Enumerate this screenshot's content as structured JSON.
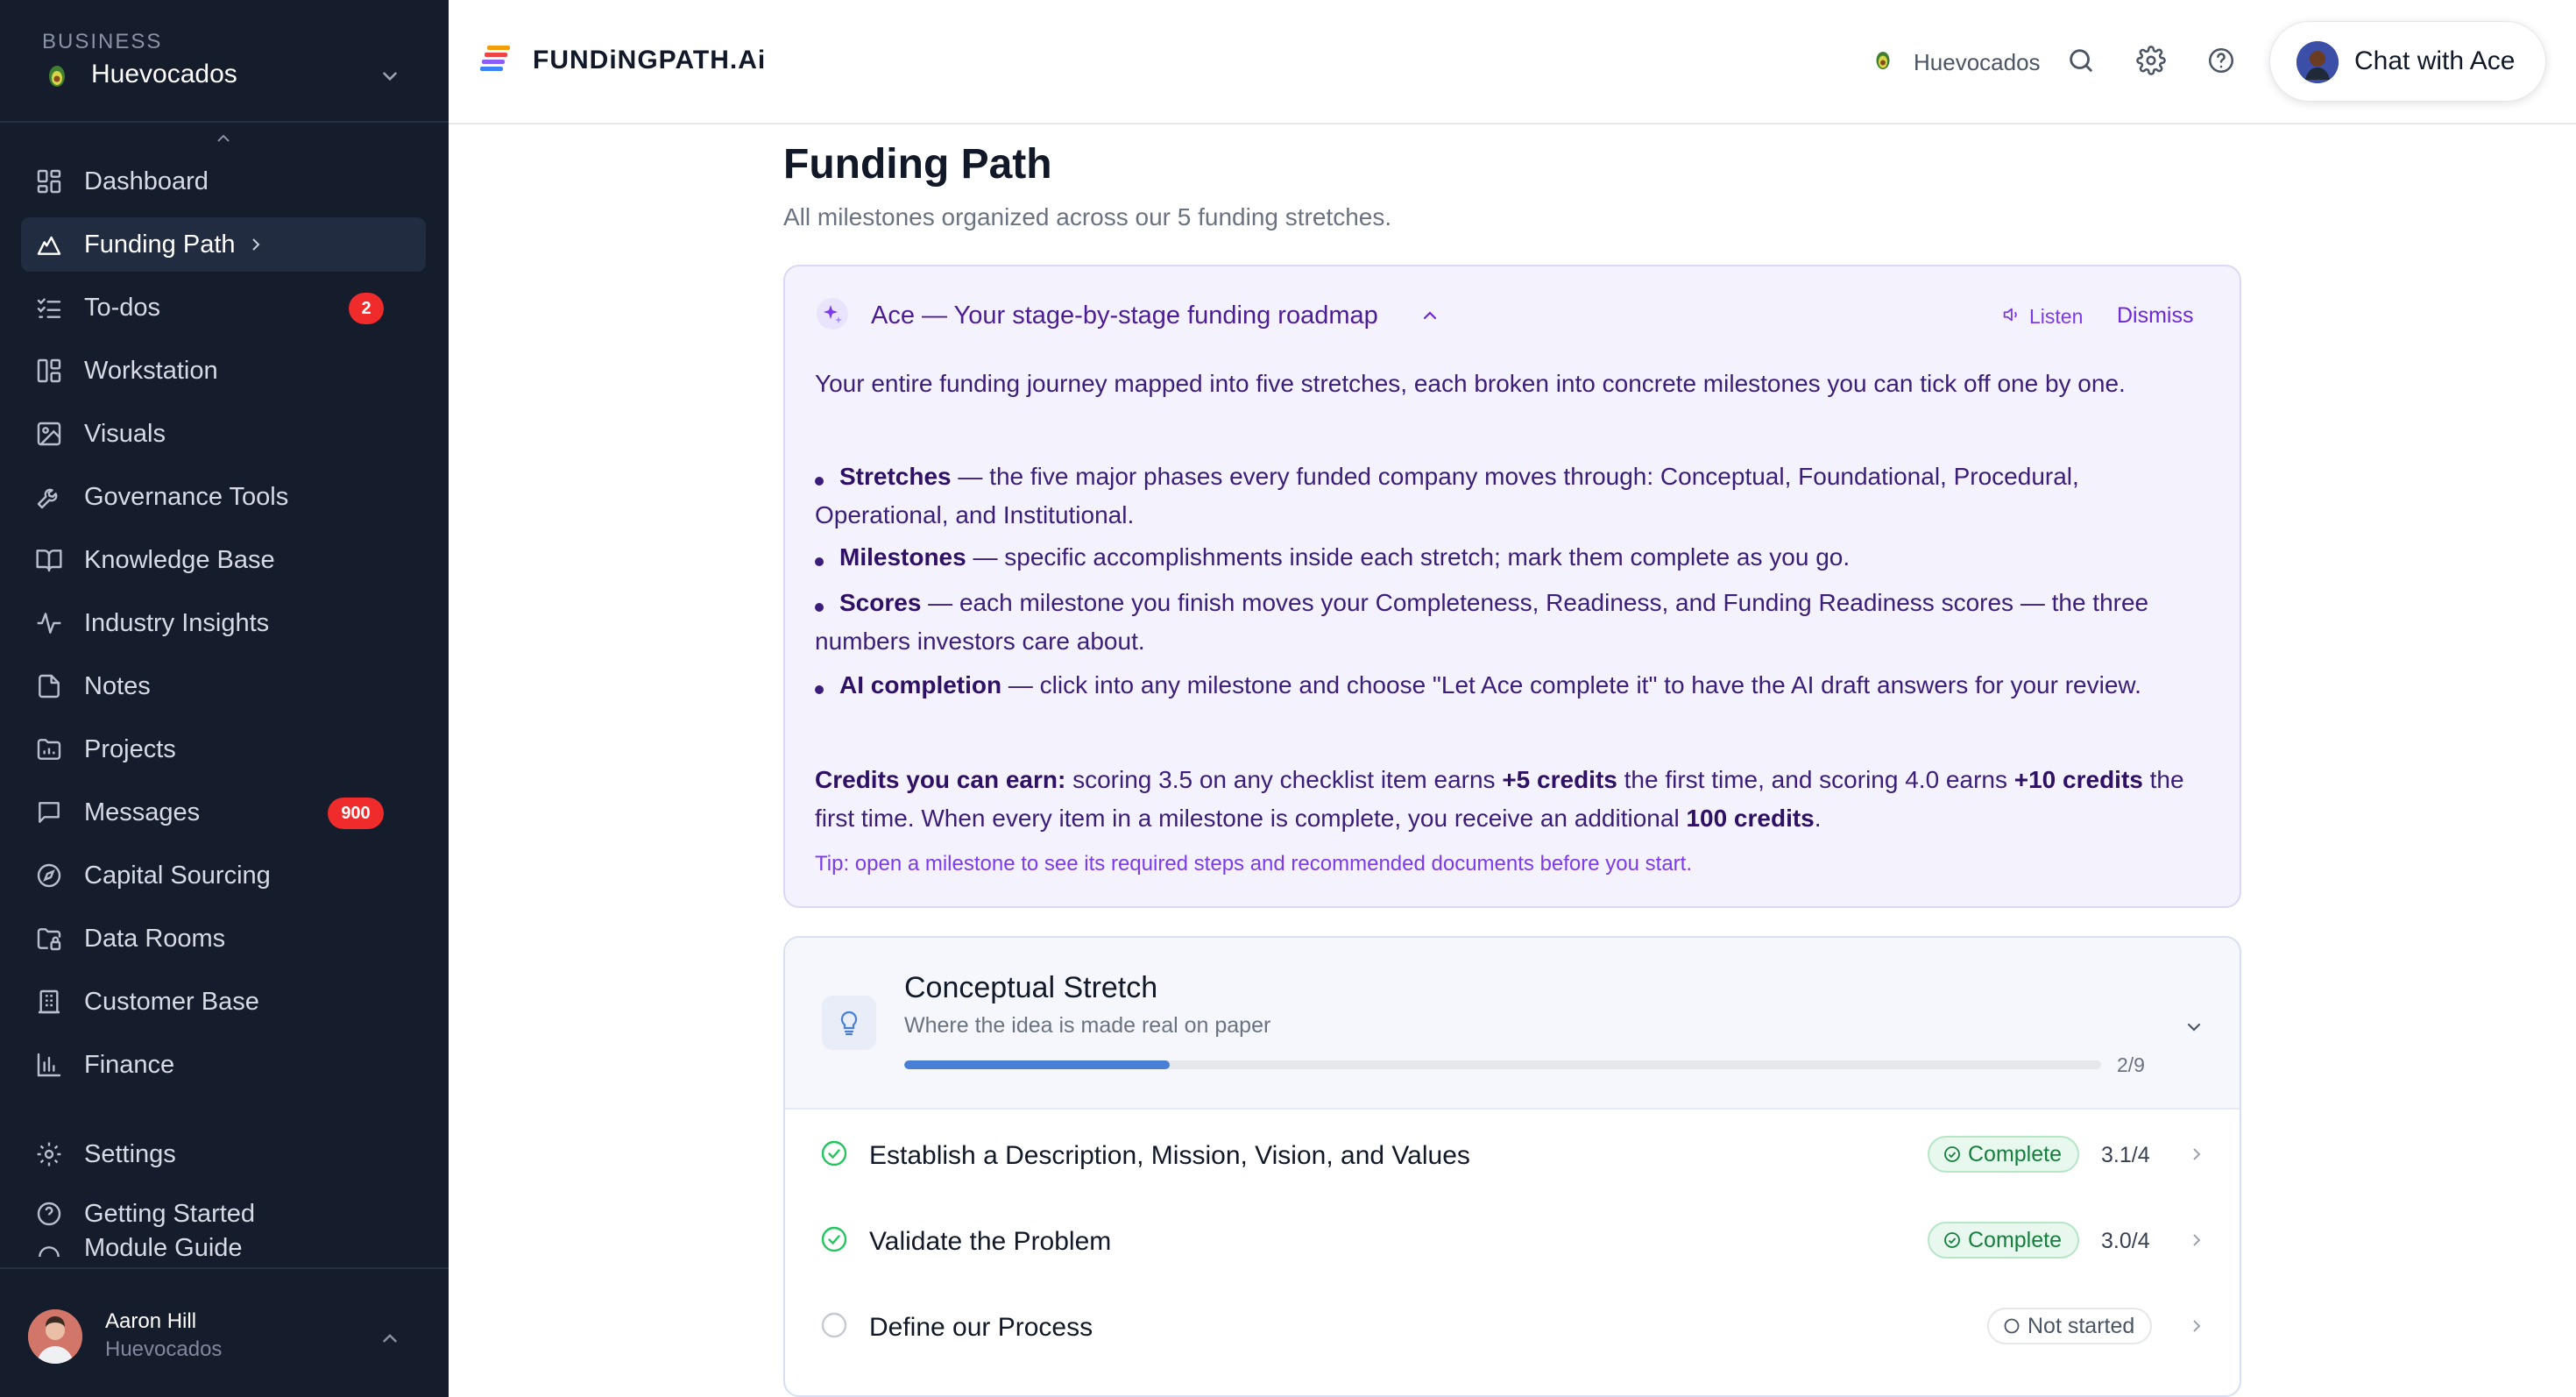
{
  "sidebar": {
    "business_label": "BUSINESS",
    "business_name": "Huevocados",
    "items": [
      {
        "label": "Dashboard",
        "icon": "dashboard-icon"
      },
      {
        "label": "Funding Path",
        "icon": "mountain-icon",
        "active": true
      },
      {
        "label": "To-dos",
        "icon": "checklist-icon",
        "badge": "2"
      },
      {
        "label": "Workstation",
        "icon": "layout-icon"
      },
      {
        "label": "Visuals",
        "icon": "image-icon"
      },
      {
        "label": "Governance Tools",
        "icon": "wrench-icon"
      },
      {
        "label": "Knowledge Base",
        "icon": "book-icon"
      },
      {
        "label": "Industry Insights",
        "icon": "activity-icon"
      },
      {
        "label": "Notes",
        "icon": "note-icon"
      },
      {
        "label": "Projects",
        "icon": "folder-icon"
      },
      {
        "label": "Messages",
        "icon": "message-icon",
        "badge": "900"
      },
      {
        "label": "Capital Sourcing",
        "icon": "compass-icon"
      },
      {
        "label": "Data Rooms",
        "icon": "folder-lock-icon"
      },
      {
        "label": "Customer Base",
        "icon": "building-icon"
      },
      {
        "label": "Finance",
        "icon": "bar-chart-icon"
      }
    ],
    "bottom_items": [
      {
        "label": "Settings",
        "icon": "gear-icon"
      },
      {
        "label": "Getting Started",
        "icon": "help-circle-icon"
      },
      {
        "label": "Module Guide",
        "icon": "guide-icon"
      }
    ],
    "user": {
      "name": "Aaron Hill",
      "business": "Huevocados"
    }
  },
  "topbar": {
    "logo": "FUNDiNGPATH.Ai",
    "business": "Huevocados",
    "chat_button": "Chat with Ace"
  },
  "page": {
    "title": "Funding Path",
    "subtitle": "All milestones organized across our 5 funding stretches."
  },
  "ace": {
    "title": "Ace — Your stage-by-stage funding roadmap",
    "listen": "Listen",
    "dismiss": "Dismiss",
    "intro": "Your entire funding journey mapped into five stretches, each broken into concrete milestones you can tick off one by one.",
    "bullets": [
      {
        "term": "Stretches",
        "text": " — the five major phases every funded company moves through: Conceptual, Foundational, Procedural, Operational, and Institutional."
      },
      {
        "term": "Milestones",
        "text": " — specific accomplishments inside each stretch; mark them complete as you go."
      },
      {
        "term": "Scores",
        "text": " — each milestone you finish moves your Completeness, Readiness, and Funding Readiness scores — the three numbers investors care about."
      },
      {
        "term": "AI completion",
        "text": " — click into any milestone and choose \"Let Ace complete it\" to have the AI draft answers for your review."
      }
    ],
    "credits": {
      "lead": "Credits you can earn:",
      "part1": " scoring 3.5 on any checklist item earns ",
      "bold1": "+5 credits",
      "part2": " the first time, and scoring 4.0 earns ",
      "bold2": "+10 credits",
      "part3": " the first time. When every item in a milestone is complete, you receive an additional ",
      "bold3": "100 credits",
      "part4": "."
    },
    "tip": "Tip: open a milestone to see its required steps and recommended documents before you start."
  },
  "stretch": {
    "title": "Conceptual Stretch",
    "subtitle": "Where the idea is made real on paper",
    "progress": 0.222,
    "count": "2/9",
    "milestones": [
      {
        "label": "Establish a Description, Mission, Vision, and Values",
        "status": "Complete",
        "score": "3.1/4"
      },
      {
        "label": "Validate the Problem",
        "status": "Complete",
        "score": "3.0/4"
      },
      {
        "label": "Define our Process",
        "status": "Not started",
        "score": ""
      }
    ]
  },
  "colors": {
    "sidebar_bg": "#151c2c",
    "accent_purple": "#6d28d9",
    "badge_red": "#ef2b2b",
    "complete_green": "#15803d",
    "progress_blue": "#4a7fd6"
  }
}
